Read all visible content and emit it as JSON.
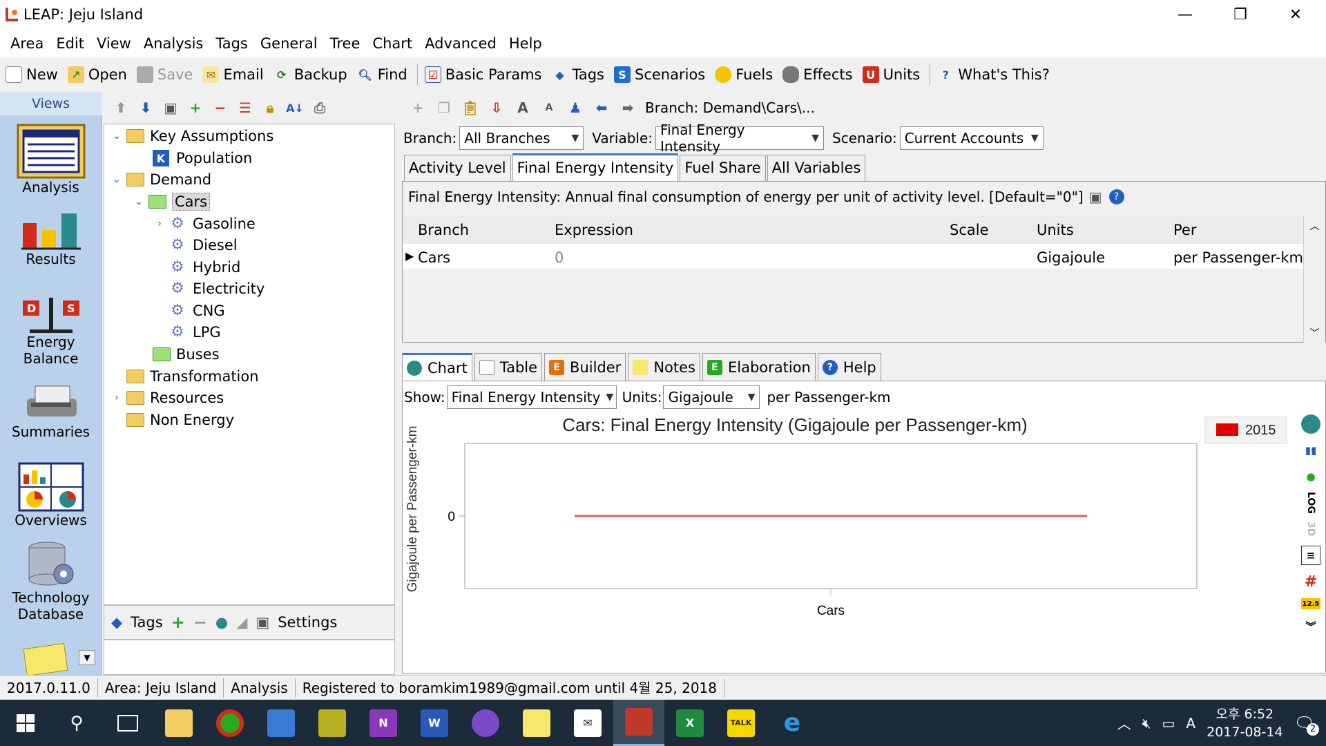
{
  "window": {
    "title": "LEAP: Jeju Island"
  },
  "menu": [
    "Area",
    "Edit",
    "View",
    "Analysis",
    "Tags",
    "General",
    "Tree",
    "Chart",
    "Advanced",
    "Help"
  ],
  "toolbar": {
    "new": "New",
    "open": "Open",
    "save": "Save",
    "email": "Email",
    "backup": "Backup",
    "find": "Find",
    "basic_params": "Basic Params",
    "tags": "Tags",
    "scenarios": "Scenarios",
    "fuels": "Fuels",
    "effects": "Effects",
    "units": "Units",
    "whats_this": "What's This?"
  },
  "views": {
    "header": "Views",
    "items": [
      "Analysis",
      "Results",
      "Energy Balance",
      "Summaries",
      "Overviews",
      "Technology Database"
    ]
  },
  "tree": {
    "key_assumptions": "Key Assumptions",
    "population": "Population",
    "demand": "Demand",
    "cars": "Cars",
    "gasoline": "Gasoline",
    "diesel": "Diesel",
    "hybrid": "Hybrid",
    "electricity": "Electricity",
    "cng": "CNG",
    "lpg": "LPG",
    "buses": "Buses",
    "transformation": "Transformation",
    "resources": "Resources",
    "non_energy": "Non Energy"
  },
  "tree_bottom": {
    "tags": "Tags",
    "settings": "Settings"
  },
  "branch_path": "Branch: Demand\\Cars\\...",
  "selectors": {
    "branch_label": "Branch:",
    "branch_value": "All Branches",
    "variable_label": "Variable:",
    "variable_value": "Final Energy Intensity",
    "scenario_label": "Scenario:",
    "scenario_value": "Current Accounts"
  },
  "var_tabs": [
    "Activity Level",
    "Final Energy Intensity",
    "Fuel Share",
    "All Variables"
  ],
  "description": "Final Energy Intensity: Annual final consumption of energy per unit of activity level. [Default=\"0\"]",
  "grid": {
    "headers": {
      "branch": "Branch",
      "expression": "Expression",
      "scale": "Scale",
      "units": "Units",
      "per": "Per"
    },
    "row": {
      "branch": "Cars",
      "expression": "0",
      "scale": "",
      "units": "Gigajoule",
      "per": "per Passenger-km"
    }
  },
  "bottom_tabs": [
    "Chart",
    "Table",
    "Builder",
    "Notes",
    "Elaboration",
    "Help"
  ],
  "chart_controls": {
    "show_label": "Show:",
    "show_value": "Final Energy Intensity",
    "units_label": "Units:",
    "units_value": "Gigajoule",
    "per": "per Passenger-km"
  },
  "side_labels": {
    "log": "LOG",
    "threed": "3D",
    "data_label": "12.5"
  },
  "chart_data": {
    "type": "line",
    "title": "Cars: Final Energy Intensity (Gigajoule per Passenger-km)",
    "ylabel": "Gigajoule per Passenger-km",
    "xlabel": "",
    "categories": [
      "Cars"
    ],
    "series": [
      {
        "name": "2015",
        "values": [
          0
        ],
        "color": "#e00000"
      }
    ],
    "y_ticks": [
      "0"
    ],
    "legend": "top-right"
  },
  "status": {
    "version": "2017.0.11.0",
    "area": "Area: Jeju Island",
    "view": "Analysis",
    "registration": "Registered to boramkim1989@gmail.com until 4월 25, 2018"
  },
  "taskbar": {
    "time": "오후 6:52",
    "date": "2017-08-14",
    "notif_count": "2",
    "ime": "A"
  },
  "colors": {
    "accent": "#3c78c8",
    "views_bg": "#b9d1ea",
    "taskbar_bg": "#1c2b3a",
    "series_line": "#e65c5c"
  }
}
